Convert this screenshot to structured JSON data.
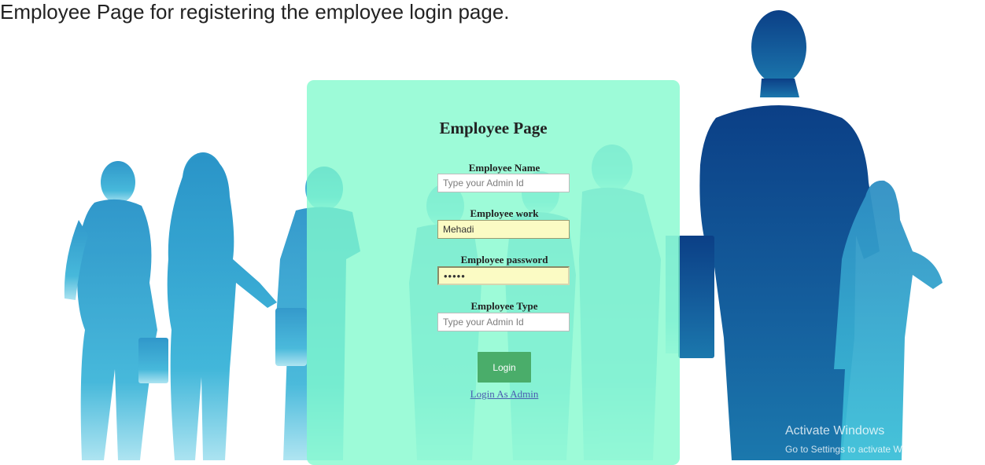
{
  "caption": "Employee Page for registering the employee login page.",
  "form": {
    "title": "Employee Page",
    "name_label": "Employee Name",
    "name_placeholder": "Type your Admin Id",
    "work_label": "Employee work",
    "work_value": "Mehadi",
    "password_label": "Employee password",
    "password_value": "admin",
    "type_label": "Employee Type",
    "type_placeholder": "Type your Admin Id",
    "login_label": "Login",
    "admin_link": "Login As Admin"
  },
  "watermark": {
    "line1": "Activate Windows",
    "line2": "Go to Settings to activate Windows."
  },
  "colors": {
    "panel": "#82fac d",
    "button": "#4aad6a",
    "silhouette_dark": "#0e4f94",
    "silhouette_light": "#2aa6cf"
  }
}
